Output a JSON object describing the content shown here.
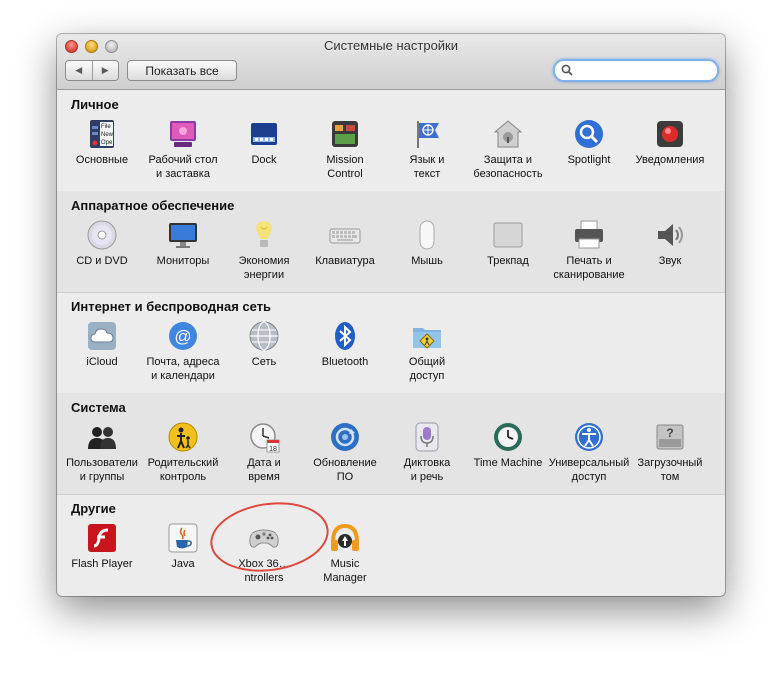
{
  "window": {
    "title": "Системные настройки"
  },
  "toolbar": {
    "back": "◀",
    "forward": "▶",
    "show_all": "Показать все",
    "search_value": ""
  },
  "sections": [
    {
      "title": "Личное",
      "items": [
        {
          "label": "Основные",
          "icon": "general-icon"
        },
        {
          "label": "Рабочий стол\nи заставка",
          "icon": "desktop-screensaver-icon"
        },
        {
          "label": "Dock",
          "icon": "dock-icon"
        },
        {
          "label": "Mission\nControl",
          "icon": "mission-control-icon"
        },
        {
          "label": "Язык и\nтекст",
          "icon": "language-text-icon"
        },
        {
          "label": "Защита и\nбезопасность",
          "icon": "security-icon"
        },
        {
          "label": "Spotlight",
          "icon": "spotlight-icon"
        },
        {
          "label": "Уведомления",
          "icon": "notifications-icon"
        }
      ],
      "icon_text": {
        "general": [
          "File",
          "New",
          "Ope"
        ]
      }
    },
    {
      "title": "Аппаратное обеспечение",
      "items": [
        {
          "label": "CD и DVD",
          "icon": "cd-dvd-icon"
        },
        {
          "label": "Мониторы",
          "icon": "displays-icon"
        },
        {
          "label": "Экономия\nэнергии",
          "icon": "energy-saver-icon"
        },
        {
          "label": "Клавиатура",
          "icon": "keyboard-icon"
        },
        {
          "label": "Мышь",
          "icon": "mouse-icon"
        },
        {
          "label": "Трекпад",
          "icon": "trackpad-icon"
        },
        {
          "label": "Печать и\nсканирование",
          "icon": "print-scan-icon"
        },
        {
          "label": "Звук",
          "icon": "sound-icon"
        }
      ]
    },
    {
      "title": "Интернет и беспроводная сеть",
      "items": [
        {
          "label": "iCloud",
          "icon": "icloud-icon"
        },
        {
          "label": "Почта, адреса\nи календари",
          "icon": "mail-contacts-icon"
        },
        {
          "label": "Сеть",
          "icon": "network-icon"
        },
        {
          "label": "Bluetooth",
          "icon": "bluetooth-icon"
        },
        {
          "label": "Общий\nдоступ",
          "icon": "sharing-icon"
        }
      ]
    },
    {
      "title": "Система",
      "items": [
        {
          "label": "Пользователи\nи группы",
          "icon": "users-groups-icon"
        },
        {
          "label": "Родительский\nконтроль",
          "icon": "parental-controls-icon"
        },
        {
          "label": "Дата и\nвремя",
          "icon": "date-time-icon"
        },
        {
          "label": "Обновление\nПО",
          "icon": "software-update-icon"
        },
        {
          "label": "Диктовка\nи речь",
          "icon": "dictation-speech-icon"
        },
        {
          "label": "Time Machine",
          "icon": "time-machine-icon"
        },
        {
          "label": "Универсальный\nдоступ",
          "icon": "accessibility-icon"
        },
        {
          "label": "Загрузочный\nтом",
          "icon": "startup-disk-icon"
        }
      ],
      "icon_text": {
        "date": "18"
      }
    },
    {
      "title": "Другие",
      "items": [
        {
          "label": "Flash Player",
          "icon": "flash-player-icon"
        },
        {
          "label": "Java",
          "icon": "java-icon"
        },
        {
          "label": "Xbox 36…ntrollers",
          "icon": "xbox-controller-icon"
        },
        {
          "label": "Music\nManager",
          "icon": "music-manager-icon"
        }
      ]
    }
  ],
  "colors": {
    "annotation_oval": "#e0473d",
    "search_focus": "#7fb1ec",
    "section_alt": "#e4e4e4",
    "window_bg": "#ececec"
  }
}
